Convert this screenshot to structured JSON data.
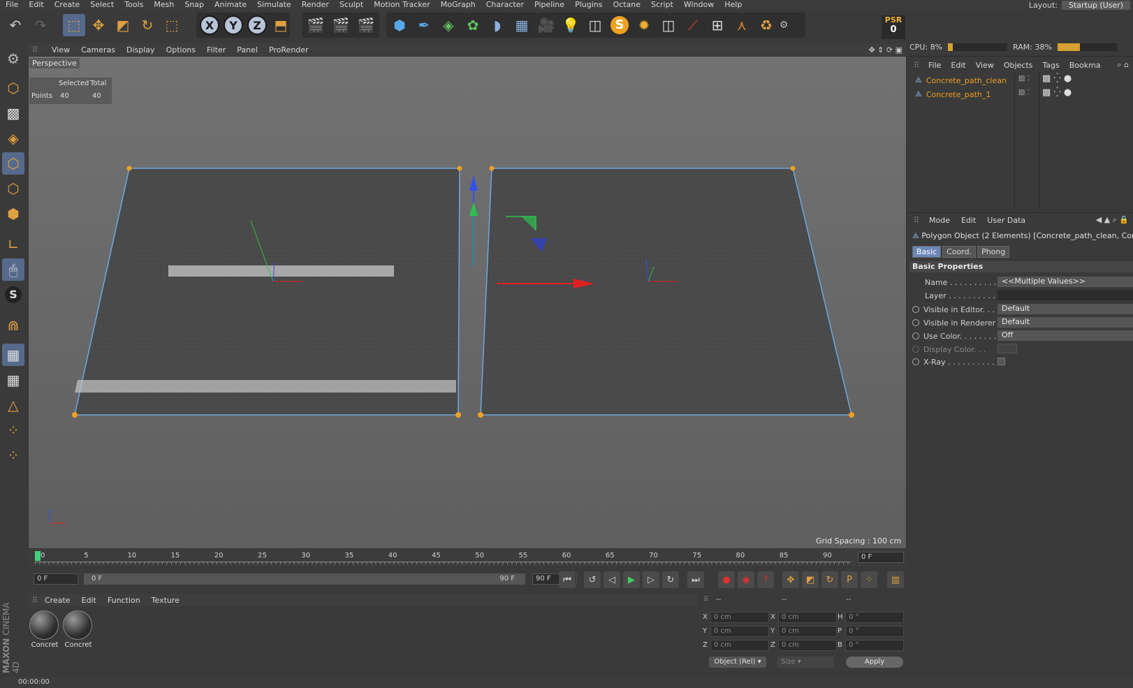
{
  "menu": [
    "File",
    "Edit",
    "Create",
    "Select",
    "Tools",
    "Mesh",
    "Snap",
    "Animate",
    "Simulate",
    "Render",
    "Sculpt",
    "Motion Tracker",
    "MoGraph",
    "Character",
    "Pipeline",
    "Plugins",
    "Octane",
    "Script",
    "Window",
    "Help"
  ],
  "layout": {
    "label": "Layout:",
    "value": "Startup (User)"
  },
  "psr": {
    "title": "PSR",
    "value": "0"
  },
  "perf": {
    "cpu_label": "CPU: 8%",
    "cpu_pct": 8,
    "ram_label": "RAM: 38%",
    "ram_pct": 38
  },
  "viewport": {
    "menu": [
      "View",
      "Cameras",
      "Display",
      "Options",
      "Filter",
      "Panel",
      "ProRender"
    ],
    "name": "Perspective",
    "hud": {
      "head1": "Selected",
      "head2": "Total",
      "row_label": "Points",
      "selected": "40",
      "total": "40"
    },
    "grid_spacing": "Grid Spacing : 100 cm"
  },
  "timeline": {
    "ticks": [
      "0",
      "5",
      "10",
      "15",
      "20",
      "25",
      "30",
      "35",
      "40",
      "45",
      "50",
      "55",
      "60",
      "65",
      "70",
      "75",
      "80",
      "85",
      "90"
    ],
    "current_frame": "0 F",
    "start": "0 F",
    "range_start": "0 F",
    "range_end": "90 F",
    "end": "90 F"
  },
  "materials": {
    "menu": [
      "Create",
      "Edit",
      "Function",
      "Texture"
    ],
    "items": [
      "Concret",
      "Concret"
    ]
  },
  "coords": {
    "headers": [
      "--",
      "--",
      "--"
    ],
    "pos": [
      {
        "axis": "X",
        "val": "0 cm"
      },
      {
        "axis": "Y",
        "val": "0 cm"
      },
      {
        "axis": "Z",
        "val": "0 cm"
      }
    ],
    "size": [
      {
        "axis": "X",
        "val": "0 cm"
      },
      {
        "axis": "Y",
        "val": "0 cm"
      },
      {
        "axis": "Z",
        "val": "0 cm"
      }
    ],
    "rot": [
      {
        "axis": "H",
        "val": "0 °"
      },
      {
        "axis": "P",
        "val": "0 °"
      },
      {
        "axis": "B",
        "val": "0 °"
      }
    ],
    "mode": "Object (Rel)",
    "size_mode": "Size",
    "apply": "Apply"
  },
  "objects": {
    "menu": [
      "File",
      "Edit",
      "View",
      "Objects",
      "Tags",
      "Bookma"
    ],
    "items": [
      "Concrete_path_clean",
      "Concrete_path_1"
    ]
  },
  "attributes": {
    "menu": [
      "Mode",
      "Edit",
      "User Data"
    ],
    "title": "Polygon Object (2 Elements) [Concrete_path_clean, Conc",
    "tabs": [
      "Basic",
      "Coord.",
      "Phong"
    ],
    "section": "Basic Properties",
    "rows": [
      {
        "label": "Name . . . . . . . . . . . .",
        "value": "<<Multiple Values>>"
      },
      {
        "label": "Layer . . . . . . . . . . . .",
        "value": ""
      },
      {
        "label": "Visible in Editor. . .",
        "value": "Default"
      },
      {
        "label": "Visible in Renderer",
        "value": "Default"
      },
      {
        "label": "Use Color. . . . . . . .",
        "value": "Off"
      },
      {
        "label": "Display Color. . .",
        "value": ""
      },
      {
        "label": "X-Ray . . . . . . . . . . .",
        "value": ""
      }
    ]
  },
  "status": {
    "time": "00:00:00"
  },
  "brand": {
    "line1": "MAXON",
    "line2": "CINEMA 4D"
  }
}
